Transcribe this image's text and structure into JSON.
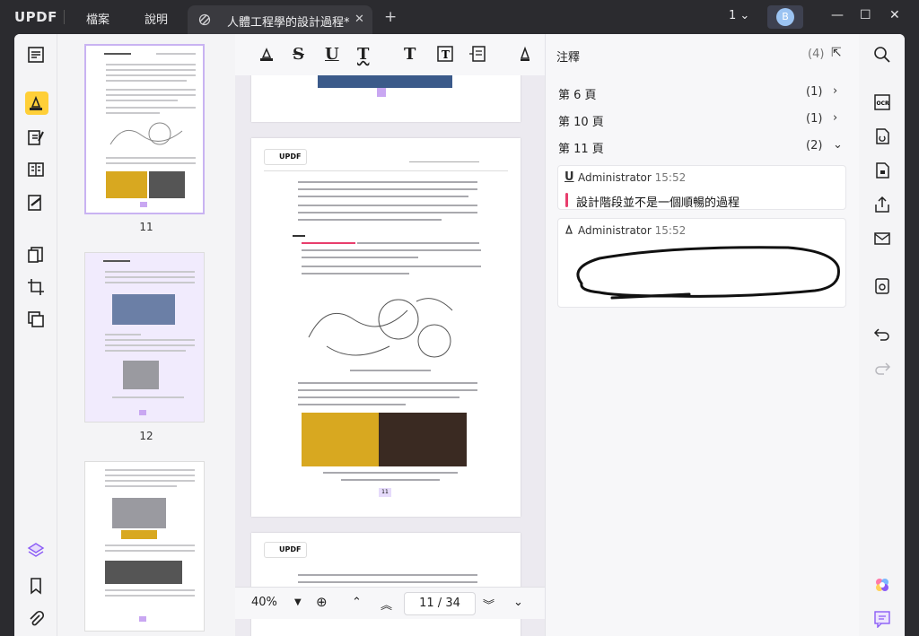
{
  "titlebar": {
    "logo": "UPDF",
    "menu": [
      "檔案",
      "說明"
    ],
    "tab_title": "人體工程學的設計過程*",
    "tab_close": "✕",
    "tab_add": "+",
    "page_indicator": "1",
    "avatar_initial": "B"
  },
  "toolbar": {
    "tools": [
      "highlight",
      "strikethrough",
      "underline",
      "squiggly",
      "text",
      "text-box",
      "text-callout",
      "pencil"
    ]
  },
  "viewer": {
    "zoom": "40%",
    "current_page": "11",
    "total_pages": "34",
    "page_separator": "/",
    "page_header_logo": "UPDF",
    "page11_label": "11"
  },
  "thumbnails": [
    {
      "label": "11",
      "selected": true
    },
    {
      "label": "12",
      "selected": false
    },
    {
      "label": "",
      "selected": false
    }
  ],
  "annotations": {
    "title": "注釋",
    "count": "(4)",
    "groups": [
      {
        "label": "第 6 頁",
        "count": "(1)",
        "expanded": false
      },
      {
        "label": "第 10 頁",
        "count": "(1)",
        "expanded": false
      },
      {
        "label": "第 11 頁",
        "count": "(2)",
        "expanded": true
      }
    ],
    "cards": [
      {
        "author": "Administrator",
        "time": "15:52",
        "type_icon": "U",
        "text": "設計階段並不是一個順暢的過程"
      },
      {
        "author": "Administrator",
        "time": "15:52",
        "type_icon": "pencil",
        "text": ""
      }
    ]
  },
  "colors": {
    "accent": "#ffcf38",
    "highlight_mark": "#e83e6d",
    "thumb_selected": "#c9b3f2"
  }
}
